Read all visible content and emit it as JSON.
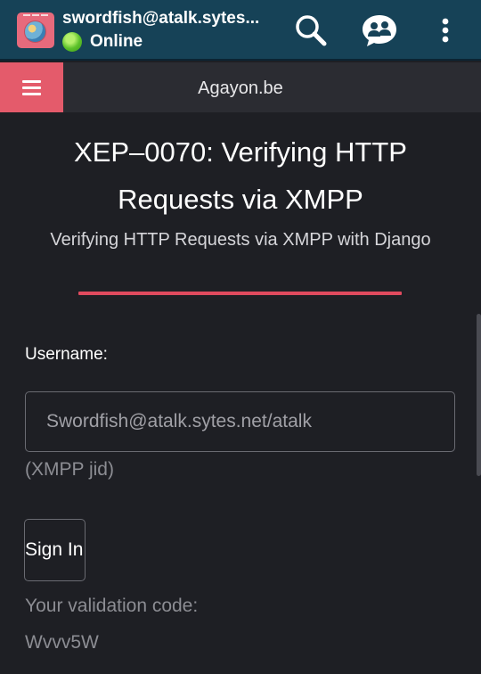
{
  "appbar": {
    "account": "swordfish@atalk.sytes...",
    "status": "Online",
    "icons": {
      "avatar": "app-avatar-icon",
      "status": "online-status-icon",
      "search": "search-icon",
      "contacts": "contacts-chat-icon",
      "more": "more-vert-icon"
    }
  },
  "navbar": {
    "menu_icon": "hamburger-menu-icon",
    "site_title": "Agayon.be"
  },
  "main": {
    "title": "XEP–0070: Verifying HTTP Requests via XMPP",
    "subtitle": "Verifying HTTP Requests via XMPP with Django",
    "username_label": "Username:",
    "username_value": "Swordfish@atalk.sytes.net/atalk",
    "username_hint": "(XMPP jid)",
    "signin_label": "Sign In",
    "validation_label": "Your validation code:",
    "validation_code": "Wvvv5W"
  },
  "colors": {
    "appbar": "#164257",
    "accent": "#e45b6b",
    "background": "#1e1f24",
    "online": "#5cc12a"
  }
}
